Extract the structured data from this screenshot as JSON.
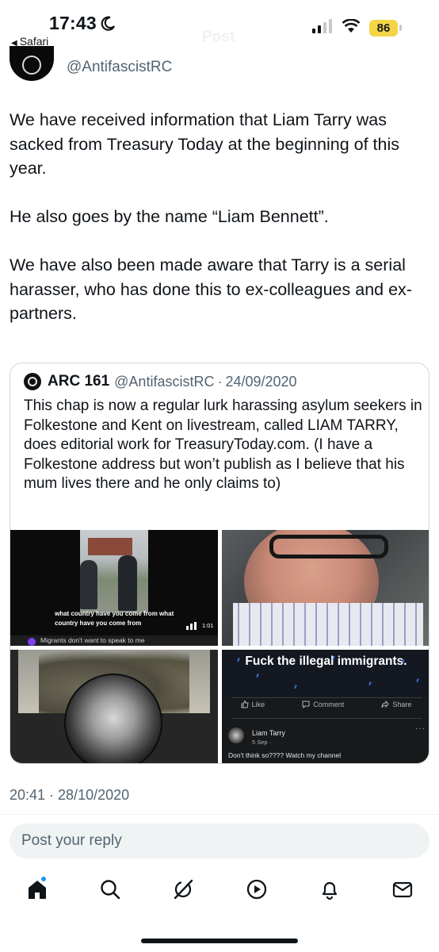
{
  "status_bar": {
    "time": "17:43",
    "back_app": "Safari",
    "faded_title": "Post",
    "battery": "86"
  },
  "author": {
    "handle": "@AntifascistRC"
  },
  "tweet": {
    "paragraphs": [
      "We have received information that Liam Tarry was sacked from Treasury Today at the beginning of this year.",
      "He also goes by the name “Liam Bennett”.",
      "We have also been made aware that Tarry is a serial harasser, who has done this to ex-colleagues and ex-partners."
    ],
    "timestamp": "20:41 · 28/10/2020"
  },
  "quote": {
    "name": "ARC 161",
    "handle": "@AntifascistRC",
    "separator": "·",
    "date": "24/09/2020",
    "text": "This chap is now a regular lurk harassing asylum seekers in Folkestone and Kent on livestream, called LIAM TARRY, does editorial work for TreasuryToday.com. (I have a Folkestone address but won’t publish as I believe that his mum lives there and he only claims to)",
    "media": {
      "video_caption": "what country have you come from what country have you come from",
      "video_duration": "1:01",
      "video_title": "Migrants don't want to speak to me",
      "banner_text": "Fuck the illegal immigrants.",
      "fb_like": "Like",
      "fb_comment": "Comment",
      "fb_share": "Share",
      "comment_author": "Liam Tarry",
      "comment_meta": "5 Sep ·",
      "comment_text": "Don't think so???? Watch my channel"
    }
  },
  "reply": {
    "placeholder": "Post your reply"
  },
  "nav": {
    "items": [
      "home-icon",
      "search-icon",
      "grok-icon",
      "video-icon",
      "notifications-icon",
      "messages-icon"
    ],
    "home_has_badge": true
  },
  "colors": {
    "accent": "#1d9bf0",
    "secondary_text": "#536471",
    "battery": "#f5d547"
  }
}
